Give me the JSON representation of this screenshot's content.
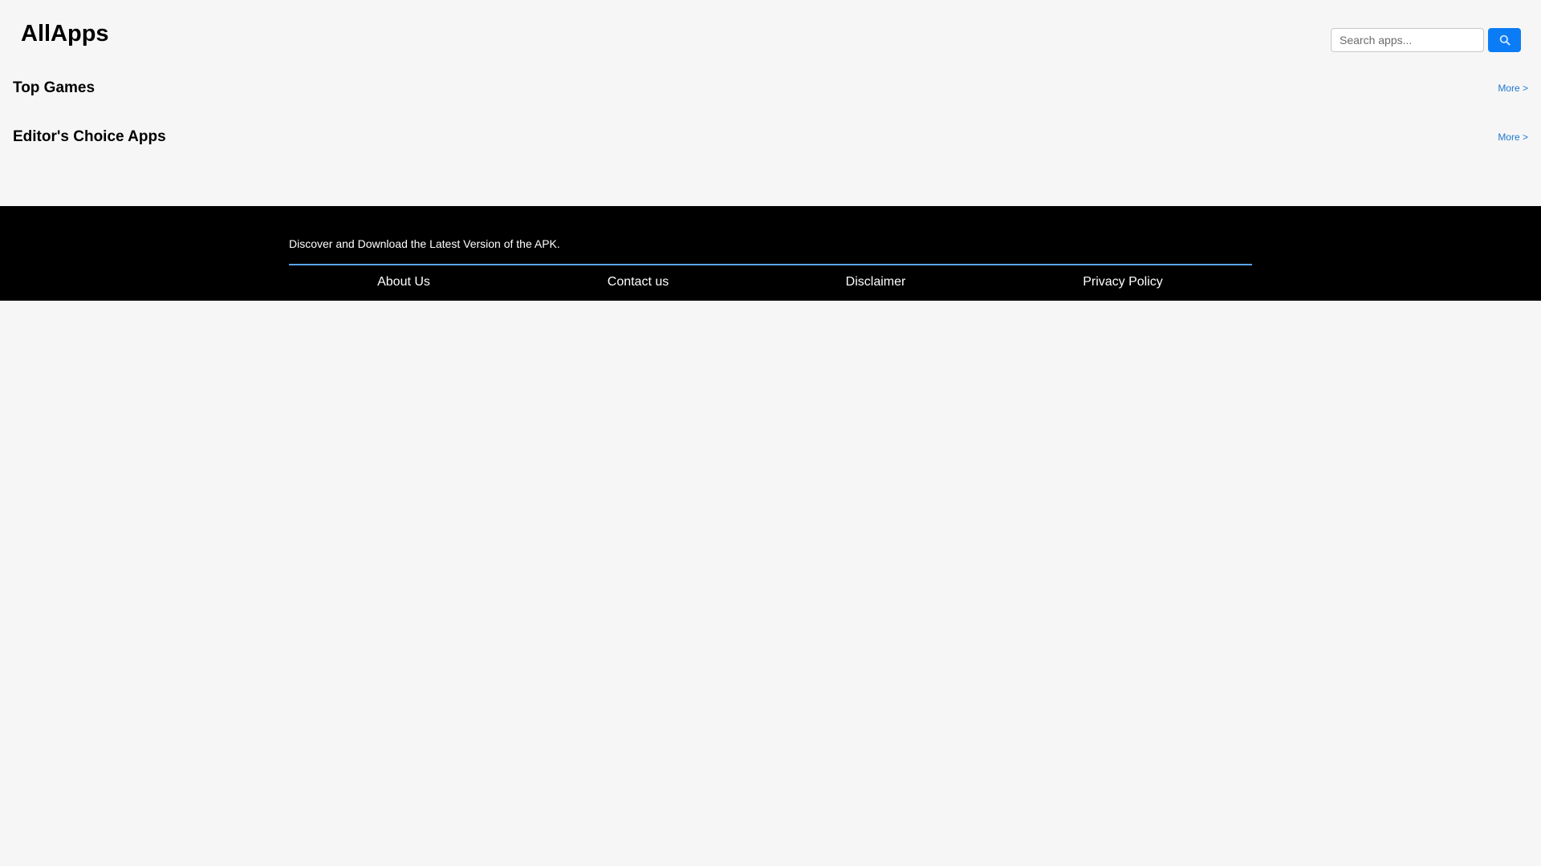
{
  "header": {
    "logo": "AllApps",
    "search": {
      "placeholder": "Search apps...",
      "value": "",
      "button_icon": "search-icon"
    }
  },
  "sections": [
    {
      "title": "Top Games",
      "more_label": "More >"
    },
    {
      "title": "Editor's Choice Apps",
      "more_label": "More >"
    }
  ],
  "footer": {
    "tagline": "Discover and Download the Latest Version of the APK.",
    "links": [
      "About Us",
      "Contact us",
      "Disclaimer",
      "Privacy Policy"
    ]
  },
  "colors": {
    "background": "#f6f6f6",
    "accent": "#0a7cf5",
    "link": "#1f78d1",
    "footer_bg": "#000000",
    "footer_divider": "#5aa5ee"
  }
}
